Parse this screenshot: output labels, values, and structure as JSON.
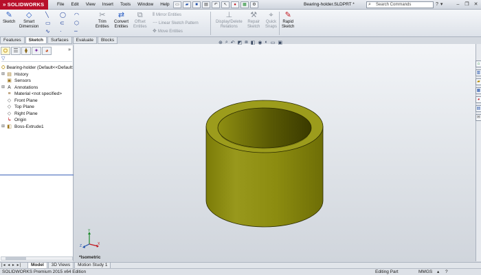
{
  "app": {
    "brand": "SOLIDWORKS",
    "document_title": "Bearing-holder.SLDPRT *"
  },
  "menu": [
    "File",
    "Edit",
    "View",
    "Insert",
    "Tools",
    "Window",
    "Help"
  ],
  "search": {
    "placeholder": "Search Commands"
  },
  "commands": {
    "sketch": "Sketch",
    "smart_dimension_1": "Smart",
    "smart_dimension_2": "Dimension",
    "trim_1": "Trim",
    "trim_2": "Entities",
    "convert_1": "Convert",
    "convert_2": "Entities",
    "offset_1": "Offset",
    "offset_2": "Entities",
    "mirror": "Mirror Entities",
    "linear_pattern": "Linear Sketch Pattern",
    "move": "Move Entities",
    "display_delete_1": "Display/Delete",
    "display_delete_2": "Relations",
    "repair_1": "Repair",
    "repair_2": "Sketch",
    "quick_snaps_1": "Quick",
    "quick_snaps_2": "Snaps",
    "rapid_1": "Rapid",
    "rapid_2": "Sketch"
  },
  "command_tabs": [
    "Features",
    "Sketch",
    "Surfaces",
    "Evaluate",
    "Blocks"
  ],
  "tree": {
    "root": "Bearing-holder  (Default<<Default>",
    "items": [
      {
        "label": "History",
        "icon": "history-icon"
      },
      {
        "label": "Sensors",
        "icon": "sensors-icon"
      },
      {
        "label": "Annotations",
        "icon": "annotations-icon"
      },
      {
        "label": "Material <not specified>",
        "icon": "material-icon"
      },
      {
        "label": "Front Plane",
        "icon": "plane-icon"
      },
      {
        "label": "Top Plane",
        "icon": "plane-icon"
      },
      {
        "label": "Right Plane",
        "icon": "plane-icon"
      },
      {
        "label": "Origin",
        "icon": "origin-icon"
      },
      {
        "label": "Boss-Extrude1",
        "icon": "extrude-icon"
      }
    ]
  },
  "viewport": {
    "view_name": "*Isometric",
    "part_color": "#8f8f12"
  },
  "bottom_tabs": [
    "Model",
    "3D Views",
    "Motion Study 1"
  ],
  "status": {
    "edition": "SOLIDWORKS Premium 2015 x64 Edition",
    "mode": "Editing Part",
    "units": "MMGS"
  }
}
